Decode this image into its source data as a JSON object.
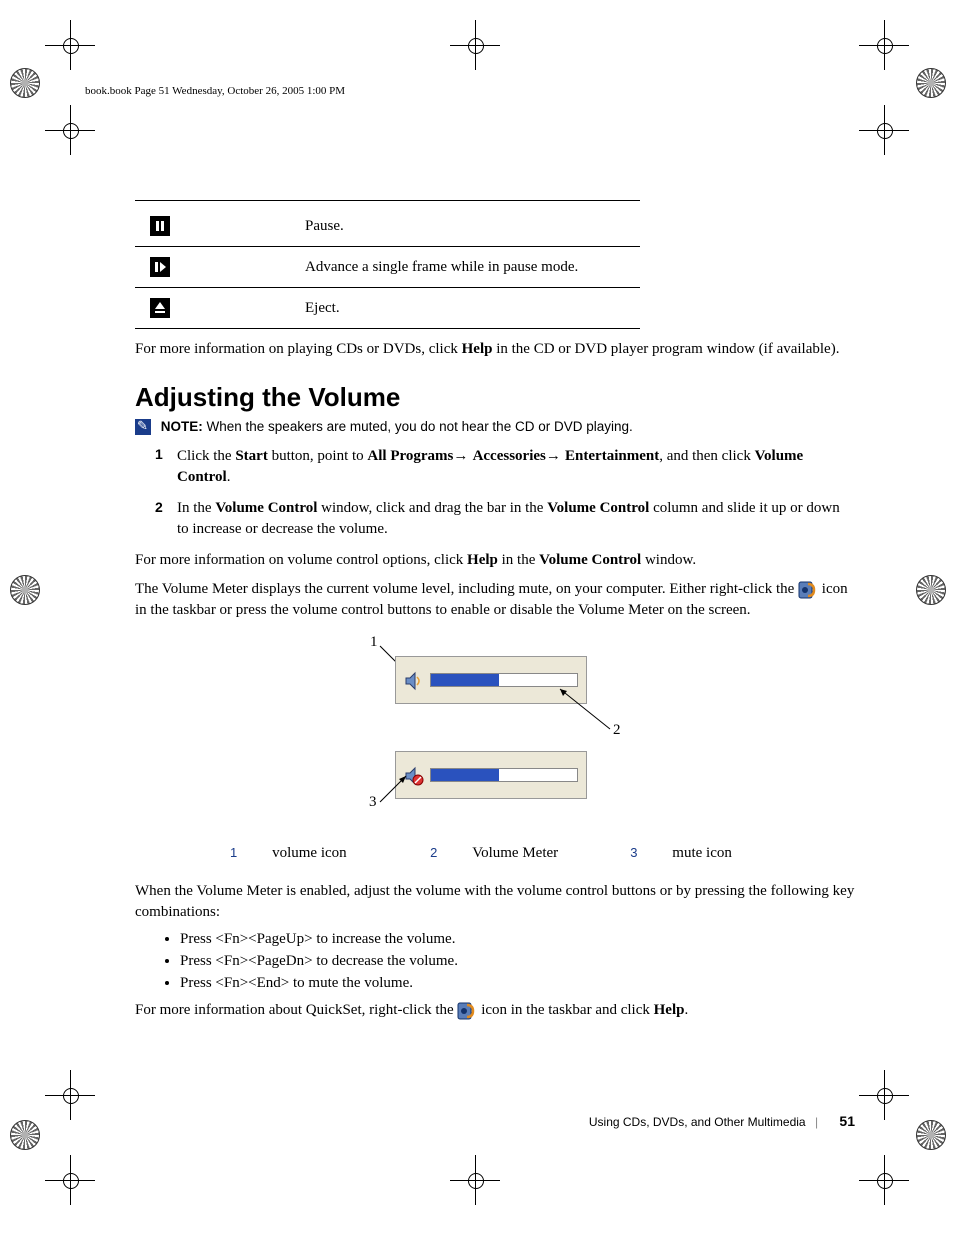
{
  "header": "book.book  Page 51  Wednesday, October 26, 2005  1:00 PM",
  "iconTable": {
    "rows": [
      {
        "desc": "Pause."
      },
      {
        "desc": "Advance a single frame while in pause mode."
      },
      {
        "desc": "Eject."
      }
    ]
  },
  "para1_a": "For more information on playing CDs or DVDs, click ",
  "para1_help": "Help",
  "para1_b": " in the CD or DVD player program window (if available).",
  "section_heading": "Adjusting the Volume",
  "note_label": "NOTE:",
  "note_text": " When the speakers are muted, you do not hear the CD or DVD playing.",
  "step1": {
    "num": "1",
    "a": "Click the ",
    "start": "Start",
    "b": " button, point to ",
    "allprog": "All Programs",
    "arr1": "→ ",
    "acc": "Accessories",
    "arr2": "→ ",
    "ent": "Entertainment",
    "c": ", and then click ",
    "vc": "Volume Control",
    "d": "."
  },
  "step2": {
    "num": "2",
    "a": "In the ",
    "vc1": "Volume Control",
    "b": " window, click and drag the bar in the ",
    "vc2": "Volume Control",
    "c": " column and slide it up or down to increase or decrease the volume."
  },
  "para2_a": "For more information on volume control options, click ",
  "para2_help": "Help",
  "para2_b": " in the ",
  "para2_vc": "Volume Control",
  "para2_c": " window.",
  "para3": "The Volume Meter displays the current volume level, including mute, on your computer. Either right-click the ",
  "para3_b": " icon in the taskbar or press the volume control buttons to enable or disable the Volume Meter on the screen.",
  "callouts": {
    "c1": "1",
    "c2": "2",
    "c3": "3"
  },
  "legend": {
    "n1": "1",
    "t1": "volume icon",
    "n2": "2",
    "t2": "Volume Meter",
    "n3": "3",
    "t3": "mute icon"
  },
  "para4": "When the Volume Meter is enabled, adjust the volume with the volume control buttons or by pressing the following key combinations:",
  "bullets": {
    "b1_a": "Press ",
    "b1_k": "<Fn><PageUp>",
    "b1_b": " to increase the volume.",
    "b2_a": "Press ",
    "b2_k": "<Fn><PageDn>",
    "b2_b": " to decrease the volume.",
    "b3_a": "Press ",
    "b3_k": "<Fn><End>",
    "b3_b": " to mute the volume."
  },
  "para5_a": "For more information about QuickSet, right-click the ",
  "para5_b": " icon in the taskbar and click ",
  "para5_help": "Help",
  "para5_c": ".",
  "footer_section": "Using CDs, DVDs, and Other Multimedia",
  "footer_page": "51"
}
